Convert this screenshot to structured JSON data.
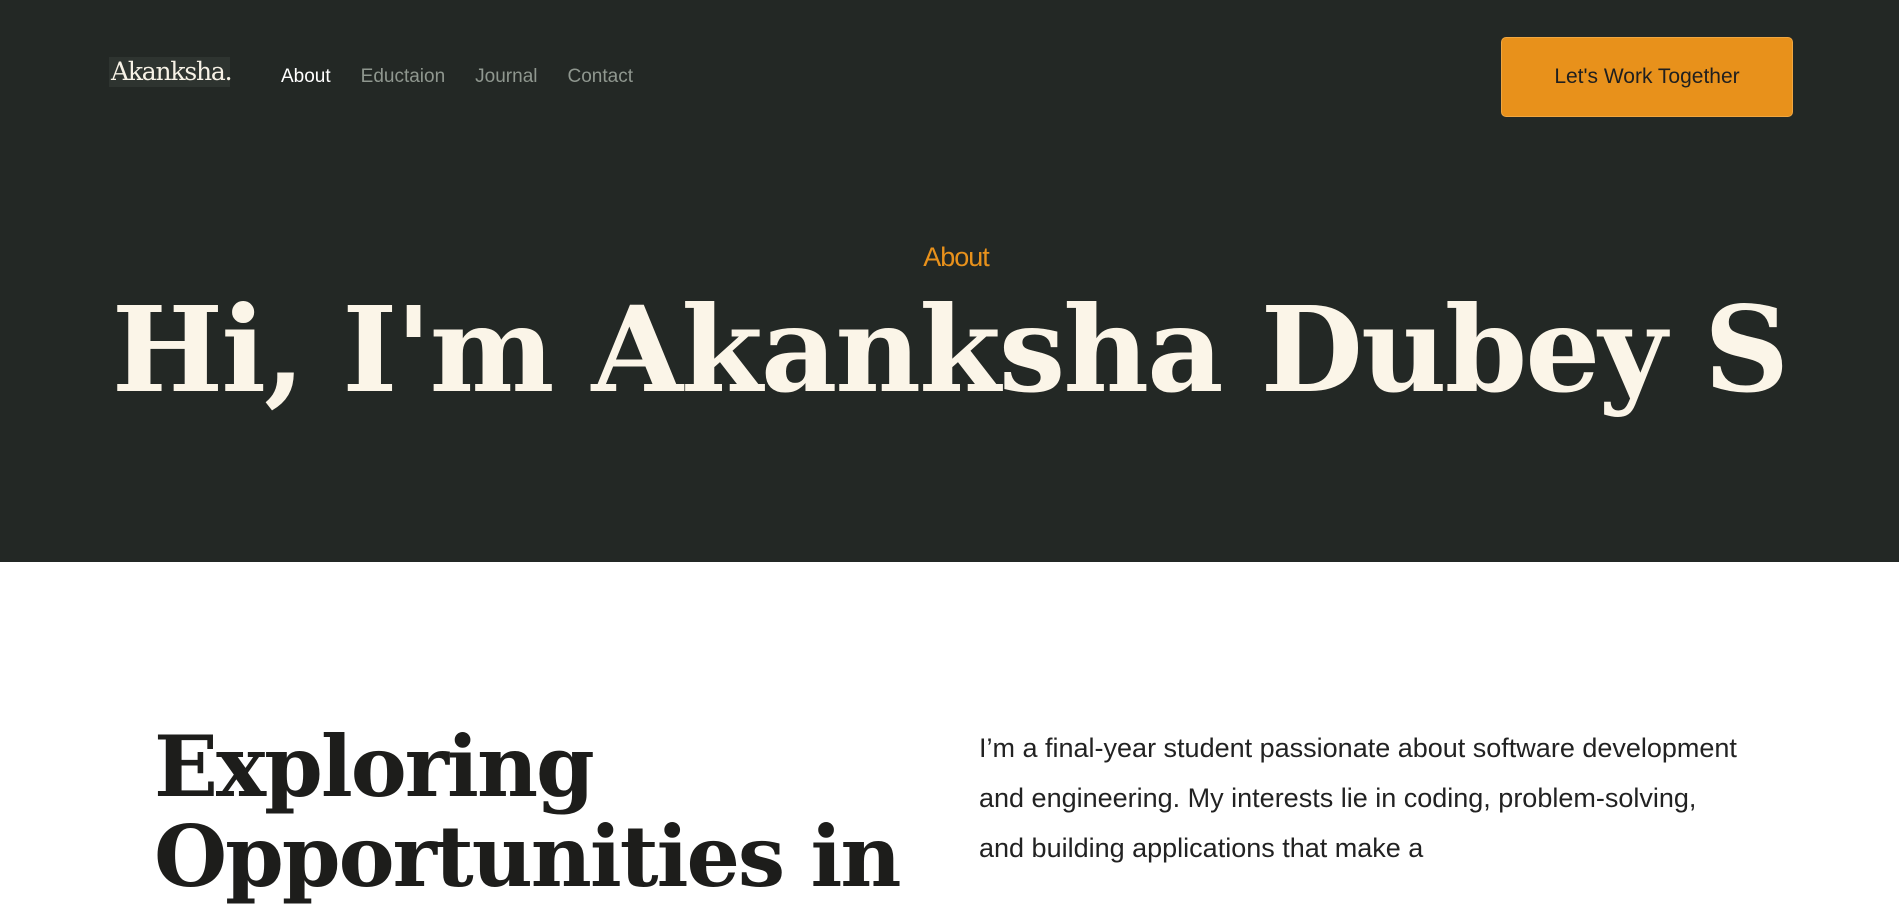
{
  "header": {
    "logo_text": "Akanksha.",
    "nav": [
      {
        "label": "About",
        "active": true
      },
      {
        "label": "Eductaion",
        "active": false
      },
      {
        "label": "Journal",
        "active": false
      },
      {
        "label": "Contact",
        "active": false
      }
    ],
    "cta_label": "Let's Work Together"
  },
  "hero": {
    "eyebrow": "About",
    "title": "Hi, I'm Akanksha Dubey S"
  },
  "about": {
    "title": "Exploring Opportunities in",
    "bio": "I’m a final-year student passionate about software development and engineering. My interests lie in coding, problem-solving, and building applications that make a"
  },
  "colors": {
    "hero_background": "#232825",
    "accent": "#e8911b",
    "hero_text": "#fbf5e8",
    "nav_inactive": "#8f978f",
    "body_text": "#222222"
  }
}
